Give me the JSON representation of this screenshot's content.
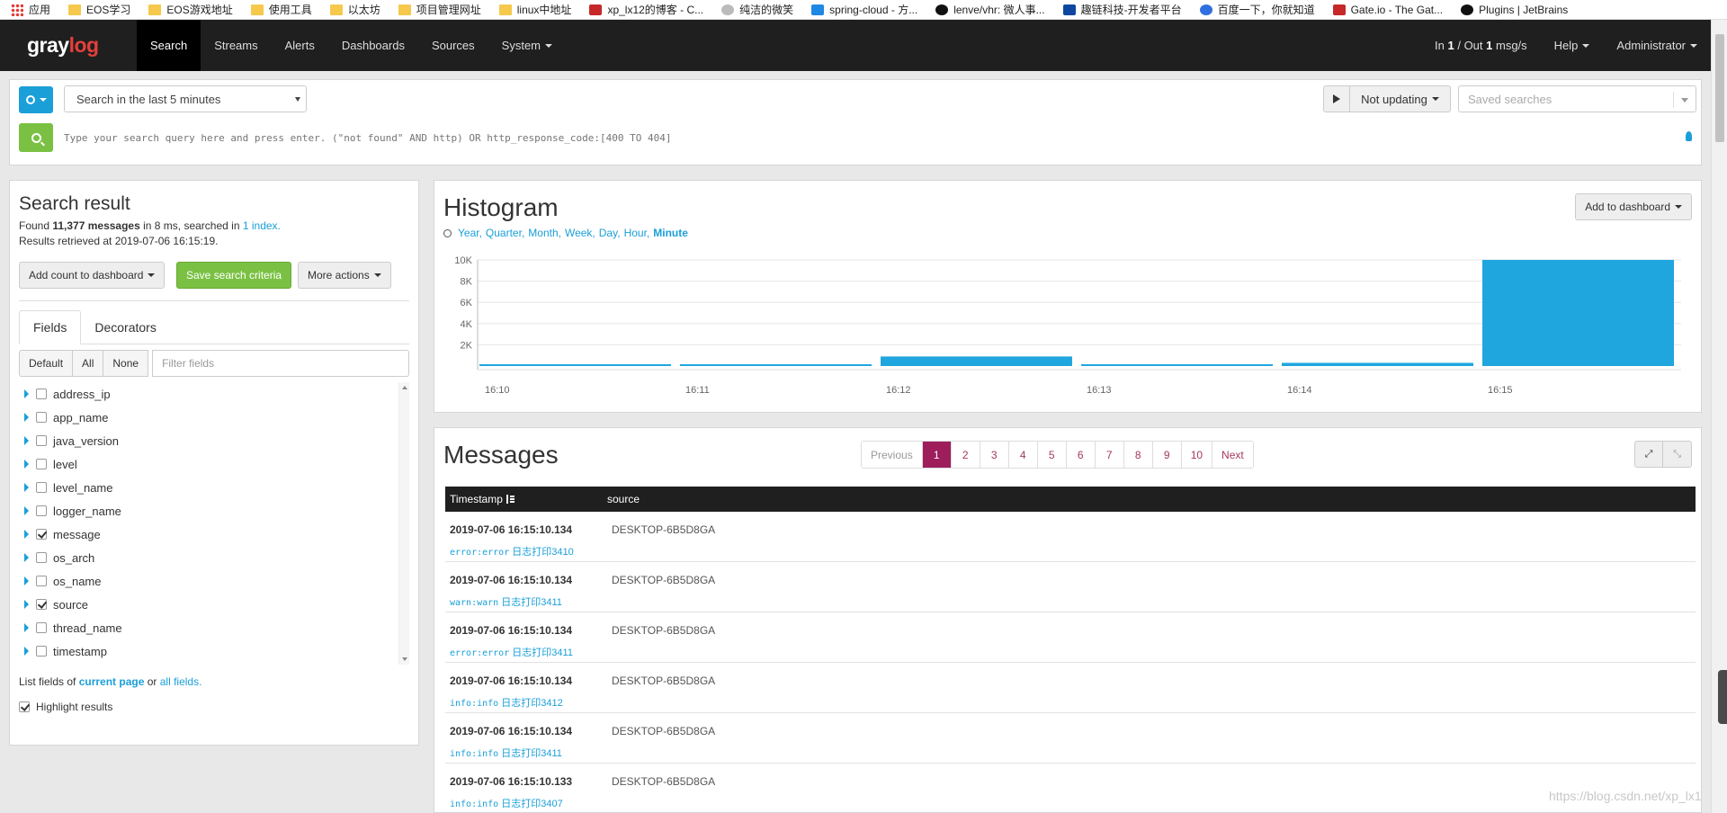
{
  "bookmarks": [
    {
      "label": "应用",
      "icon": "apps-icon"
    },
    {
      "label": "EOS学习",
      "icon": "folder-icon"
    },
    {
      "label": "EOS游戏地址",
      "icon": "folder-icon"
    },
    {
      "label": "使用工具",
      "icon": "folder-icon"
    },
    {
      "label": "以太坊",
      "icon": "folder-icon"
    },
    {
      "label": "项目管理网址",
      "icon": "folder-icon"
    },
    {
      "label": "linux中地址",
      "icon": "folder-icon"
    },
    {
      "label": "xp_lx12的博客 - C...",
      "icon": "csdn-icon"
    },
    {
      "label": "纯洁的微笑",
      "icon": "smile-icon"
    },
    {
      "label": "spring-cloud - 方...",
      "icon": "f-icon"
    },
    {
      "label": "lenve/vhr: 微人事...",
      "icon": "github-icon"
    },
    {
      "label": "趣链科技-开发者平台",
      "icon": "qulian-icon"
    },
    {
      "label": "百度一下，你就知道",
      "icon": "baidu-icon"
    },
    {
      "label": "Gate.io - The Gat...",
      "icon": "gate-icon"
    },
    {
      "label": "Plugins | JetBrains",
      "icon": "jetbrains-icon"
    }
  ],
  "nav": {
    "logo_main": "gray",
    "logo_accent": "log",
    "items": [
      "Search",
      "Streams",
      "Alerts",
      "Dashboards",
      "Sources",
      "System"
    ],
    "throughput": {
      "prefix": "In ",
      "in": "1",
      "mid": " / Out ",
      "out": "1",
      "suffix": " msg/s"
    },
    "help": "Help",
    "user": "Administrator"
  },
  "search": {
    "range": "Search in the last 5 minutes",
    "updating": "Not updating",
    "saved_placeholder": "Saved searches",
    "query_placeholder": "Type your search query here and press enter. (\"not found\" AND http) OR http_response_code:[400 TO 404]"
  },
  "result": {
    "title": "Search result",
    "found_prefix": "Found ",
    "count": "11,377 messages",
    "found_mid": " in 8 ms, searched in ",
    "index_link": "1 index.",
    "retrieved": "Results retrieved at 2019-07-06 16:15:19.",
    "add_count": "Add count to dashboard",
    "save_criteria": "Save search criteria",
    "more_actions": "More actions",
    "tabs": [
      "Fields",
      "Decorators"
    ],
    "filter_buttons": [
      "Default",
      "All",
      "None"
    ],
    "filter_placeholder": "Filter fields",
    "fields": [
      {
        "name": "address_ip",
        "checked": false
      },
      {
        "name": "app_name",
        "checked": false
      },
      {
        "name": "java_version",
        "checked": false
      },
      {
        "name": "level",
        "checked": false
      },
      {
        "name": "level_name",
        "checked": false
      },
      {
        "name": "logger_name",
        "checked": false
      },
      {
        "name": "message",
        "checked": true
      },
      {
        "name": "os_arch",
        "checked": false
      },
      {
        "name": "os_name",
        "checked": false
      },
      {
        "name": "source",
        "checked": true
      },
      {
        "name": "thread_name",
        "checked": false
      },
      {
        "name": "timestamp",
        "checked": false
      }
    ],
    "list_prefix": "List fields of ",
    "current_page": "current page",
    "list_or": " or ",
    "all_fields": "all fields.",
    "highlight": "Highlight results"
  },
  "histogram": {
    "title": "Histogram",
    "resolutions": [
      "Year,",
      "Quarter,",
      "Month,",
      "Week,",
      "Day,",
      "Hour,",
      "Minute"
    ],
    "add_dashboard": "Add to dashboard"
  },
  "chart_data": {
    "type": "bar",
    "categories": [
      "16:10",
      "16:11",
      "16:12",
      "16:13",
      "16:14",
      "16:15"
    ],
    "values": [
      120,
      100,
      900,
      60,
      300,
      10000
    ],
    "ylim": [
      0,
      10000
    ],
    "yticks": [
      "2K",
      "4K",
      "6K",
      "8K",
      "10K"
    ],
    "ytick_values": [
      2000,
      4000,
      6000,
      8000,
      10000
    ],
    "color": "#1fa6de",
    "grid": true
  },
  "messages": {
    "title": "Messages",
    "pages": [
      "Previous",
      "1",
      "2",
      "3",
      "4",
      "5",
      "6",
      "7",
      "8",
      "9",
      "10",
      "Next"
    ],
    "col_timestamp": "Timestamp",
    "col_source": "source",
    "rows": [
      {
        "ts": "2019-07-06 16:15:10.134",
        "source": "DESKTOP-6B5D8GA",
        "level": "error:error",
        "text": "日志打印3410"
      },
      {
        "ts": "2019-07-06 16:15:10.134",
        "source": "DESKTOP-6B5D8GA",
        "level": "warn:warn",
        "text": "日志打印3411"
      },
      {
        "ts": "2019-07-06 16:15:10.134",
        "source": "DESKTOP-6B5D8GA",
        "level": "error:error",
        "text": "日志打印3411"
      },
      {
        "ts": "2019-07-06 16:15:10.134",
        "source": "DESKTOP-6B5D8GA",
        "level": "info:info",
        "text": "日志打印3412"
      },
      {
        "ts": "2019-07-06 16:15:10.134",
        "source": "DESKTOP-6B5D8GA",
        "level": "info:info",
        "text": "日志打印3411"
      },
      {
        "ts": "2019-07-06 16:15:10.133",
        "source": "DESKTOP-6B5D8GA",
        "level": "info:info",
        "text": "日志打印3407"
      }
    ]
  },
  "watermark": "https://blog.csdn.net/xp_lx1"
}
